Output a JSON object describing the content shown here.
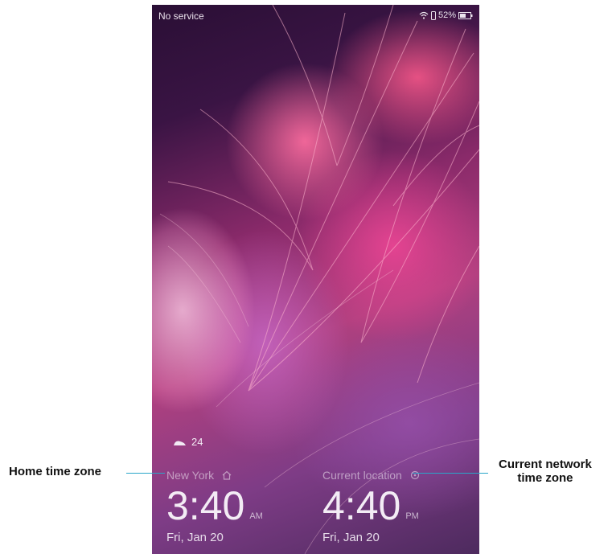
{
  "status_bar": {
    "carrier": "No service",
    "battery": "52%"
  },
  "weather": {
    "icon": "weather-icon",
    "value": "24"
  },
  "home_clock": {
    "city": "New York",
    "time": "3:40",
    "ampm": "AM",
    "date": "Fri, Jan 20"
  },
  "network_clock": {
    "city": "Current location",
    "time": "4:40",
    "ampm": "PM",
    "date": "Fri, Jan 20"
  },
  "annotations": {
    "home": "Home time zone",
    "network_line1": "Current network",
    "network_line2": "time zone",
    "line_color": "#2aa6c9"
  }
}
